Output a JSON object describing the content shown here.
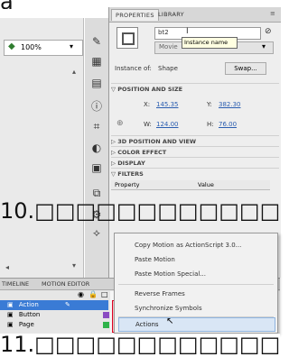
{
  "top_caption": "a",
  "left_panel": {
    "zoom_value": "100%"
  },
  "properties_panel": {
    "tabs": [
      "PROPERTIES",
      "LIBRARY"
    ],
    "instance_name_value": "bt2",
    "instance_name_tooltip": "Instance name",
    "type_select": "Movie",
    "instance_of_label": "Instance of:",
    "instance_of_value": "Shape",
    "swap_button": "Swap...",
    "position_size_header": "POSITION AND SIZE",
    "x_label": "X:",
    "x_value": "145.35",
    "y_label": "Y:",
    "y_value": "382.30",
    "w_label": "W:",
    "w_value": "124.00",
    "h_label": "H:",
    "h_value": "76.00",
    "sections": [
      "3D POSITION AND VIEW",
      "COLOR EFFECT",
      "DISPLAY",
      "FILTERS"
    ],
    "filters_table_headers": [
      "Property",
      "Value"
    ]
  },
  "caption_10": "10.□□□□□□□□□□□□□□□",
  "context_menu": {
    "items": [
      "Copy Motion as ActionScript 3.0...",
      "Paste Motion",
      "Paste Motion Special...",
      "Reverse Frames",
      "Synchronize Symbols",
      "Actions"
    ]
  },
  "timeline": {
    "tabs": [
      "TIMELINE",
      "MOTION EDITOR"
    ],
    "layers": [
      "Action",
      "Button",
      "Page"
    ],
    "colors": {
      "action": "#3a7bd5",
      "button": "#8a4cc2",
      "page": "#2fb34a"
    }
  },
  "caption_11": "11.□□□□□□□□□□□□□□□"
}
